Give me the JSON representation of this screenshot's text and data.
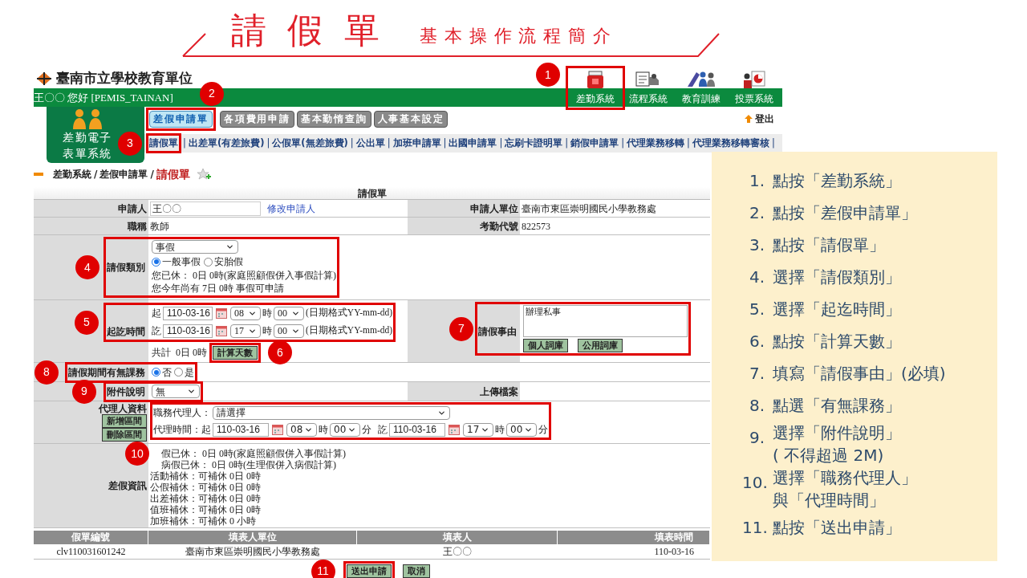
{
  "slide": {
    "title": "請假單",
    "subtitle": "基本操作流程簡介"
  },
  "header": {
    "org_name": "臺南市立學校教育單位",
    "greeting": "王〇〇 您好 [PEMIS_TAINAN]",
    "system_icons": [
      {
        "label": "差勤系統",
        "kind": "attendance"
      },
      {
        "label": "流程系統",
        "kind": "flow"
      },
      {
        "label": "教育訓練",
        "kind": "training"
      },
      {
        "label": "投票系統",
        "kind": "vote"
      }
    ],
    "logo_text": [
      "差勤電子",
      "表單系統"
    ],
    "tabs": [
      {
        "label": "差假申請單",
        "selected": true
      },
      {
        "label": "各項費用申請",
        "selected": false
      },
      {
        "label": "基本勤惰查詢",
        "selected": false
      },
      {
        "label": "人事基本設定",
        "selected": false
      }
    ],
    "logout": "登出",
    "links": [
      "請假單",
      "出差單(有差旅費)",
      "公假單(無差旅費)",
      "公出單",
      "加班申請單",
      "出國申請單",
      "忘刷卡證明單",
      "銷假申請單",
      "代理業務移轉",
      "代理業務移轉審核"
    ],
    "link_separator": "|"
  },
  "breadcrumb": {
    "items": [
      "差勤系統",
      "差假申請單",
      "請假單"
    ],
    "separator": "/"
  },
  "form": {
    "title": "請假單",
    "applicant": {
      "label": "申請人",
      "value": "王〇〇",
      "link": "修改申請人"
    },
    "unit": {
      "label": "申請人單位",
      "value": "臺南市東區崇明國民小學教務處"
    },
    "job_title": {
      "label": "職稱",
      "value": "教師"
    },
    "attendance_code": {
      "label": "考勤代號",
      "value": "822573"
    },
    "leave_type": {
      "label": "請假類別",
      "select": "事假",
      "options": [
        {
          "label": "一般事假",
          "selected": true
        },
        {
          "label": "安胎假",
          "selected": false
        }
      ],
      "notes": [
        "您已休： 0日 0時(家庭照顧假併入事假計算)",
        "您今年尚有 7日 0時 事假可申請"
      ]
    },
    "period": {
      "label": "起訖時間",
      "rows": [
        {
          "prefix": "起",
          "date": "110-03-16",
          "hour": "08",
          "hour_unit": "時",
          "minute": "00",
          "format_note": "(日期格式YY-mm-dd)"
        },
        {
          "prefix": "訖",
          "date": "110-03-16",
          "hour": "17",
          "hour_unit": "時",
          "minute": "00",
          "format_note": "(日期格式YY-mm-dd)"
        }
      ],
      "total": "共計  0日 0時",
      "calc_button": "計算天數"
    },
    "reason": {
      "label": "請假事由",
      "value": "辦理私事",
      "buttons": [
        "個人詞庫",
        "公用詞庫"
      ]
    },
    "classes": {
      "label": "請假期間有無課務",
      "options": [
        {
          "label": "否",
          "selected": true
        },
        {
          "label": "是",
          "selected": false
        }
      ]
    },
    "attachment": {
      "label": "附件說明",
      "value": "無"
    },
    "upload": {
      "label": "上傳檔案"
    },
    "deputy": {
      "label": "代理人資料",
      "buttons": [
        "新增區間",
        "刪除區間"
      ],
      "deputy_label": "職務代理人：",
      "deputy_value": "請選擇",
      "time_label": "代理時間：起",
      "start": {
        "date": "110-03-16",
        "hour": "08",
        "hour_unit": "時",
        "minute": "00",
        "minute_unit": "分"
      },
      "end_label": "訖",
      "end": {
        "date": "110-03-16",
        "hour": "17",
        "hour_unit": "時",
        "minute": "00",
        "minute_unit": "分"
      }
    },
    "leave_info": {
      "label": "差假資訊",
      "lines": [
        "假已休： 0日 0時(家庭照顧假併入事假計算)",
        "病假已休： 0日 0時(生理假併入病假計算)",
        "活動補休：可補休 0日 0時",
        "公假補休：可補休 0日 0時",
        "出差補休：可補休 0日 0時",
        "值班補休：可補休 0日 0時",
        "加班補休：可補休 0 小時"
      ]
    }
  },
  "record_table": {
    "columns": [
      "假單編號",
      "填表人單位",
      "填表人",
      "填表時間"
    ],
    "rows": [
      [
        "clv110031601242",
        "臺南市東區崇明國民小學教務處",
        "王〇〇",
        "110-03-16"
      ]
    ]
  },
  "actions": [
    "送出申請",
    "取消"
  ],
  "steps": [
    {
      "number": "1.",
      "lines": [
        "點按「差勤系統」"
      ]
    },
    {
      "number": "2.",
      "lines": [
        "點按「差假申請單」"
      ]
    },
    {
      "number": "3.",
      "lines": [
        "點按「請假單」"
      ]
    },
    {
      "number": "4.",
      "lines": [
        "選擇「請假類別」"
      ]
    },
    {
      "number": "5.",
      "lines": [
        "選擇「起迄時間」"
      ]
    },
    {
      "number": "6.",
      "lines": [
        "點按「計算天數」"
      ]
    },
    {
      "number": "7.",
      "lines": [
        "填寫「請假事由」(必填)"
      ]
    },
    {
      "number": "8.",
      "lines": [
        "點選「有無課務」"
      ]
    },
    {
      "number": "9.",
      "lines": [
        "選擇「附件說明」",
        "( 不得超過 2M)"
      ]
    },
    {
      "number": "10.",
      "lines": [
        "選擇「職務代理人」",
        "與「代理時間」"
      ]
    },
    {
      "number": "11.",
      "lines": [
        "點按「送出申請」"
      ]
    }
  ],
  "callouts": [
    "1",
    "2",
    "3",
    "4",
    "5",
    "6",
    "7",
    "8",
    "9",
    "10",
    "11"
  ]
}
